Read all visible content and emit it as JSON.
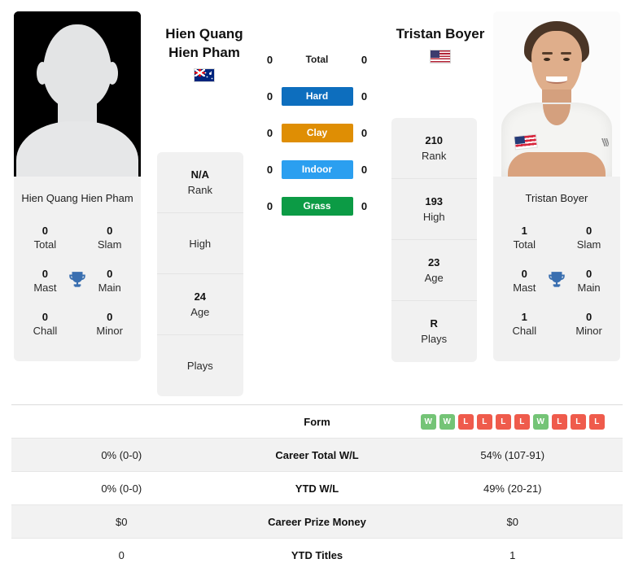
{
  "players": {
    "left": {
      "name": "Hien Quang Hien Pham",
      "header_line1": "Hien Quang",
      "header_line2": "Hien Pham",
      "flag": "australia-flag",
      "photo": "silhouette-placeholder",
      "titles": {
        "total_value": "0",
        "total_label": "Total",
        "slam_value": "0",
        "slam_label": "Slam",
        "mast_value": "0",
        "mast_label": "Mast",
        "main_value": "0",
        "main_label": "Main",
        "chall_value": "0",
        "chall_label": "Chall",
        "minor_value": "0",
        "minor_label": "Minor"
      },
      "info": [
        {
          "value": "N/A",
          "label": "Rank"
        },
        {
          "value": "",
          "label": "High"
        },
        {
          "value": "24",
          "label": "Age"
        },
        {
          "value": "",
          "label": "Plays"
        }
      ]
    },
    "right": {
      "name": "Tristan Boyer",
      "header_line1": "Tristan Boyer",
      "header_line2": "",
      "flag": "usa-flag",
      "photo": "player-portrait",
      "titles": {
        "total_value": "1",
        "total_label": "Total",
        "slam_value": "0",
        "slam_label": "Slam",
        "mast_value": "0",
        "mast_label": "Mast",
        "main_value": "0",
        "main_label": "Main",
        "chall_value": "1",
        "chall_label": "Chall",
        "minor_value": "0",
        "minor_label": "Minor"
      },
      "info": [
        {
          "value": "210",
          "label": "Rank"
        },
        {
          "value": "193",
          "label": "High"
        },
        {
          "value": "23",
          "label": "Age"
        },
        {
          "value": "R",
          "label": "Plays"
        }
      ]
    }
  },
  "surfaces": [
    {
      "label": "Total",
      "left": "0",
      "right": "0",
      "color": "transparent",
      "plain": true
    },
    {
      "label": "Hard",
      "left": "0",
      "right": "0",
      "color": "#0d6ebe",
      "plain": false
    },
    {
      "label": "Clay",
      "left": "0",
      "right": "0",
      "color": "#df8e04",
      "plain": false
    },
    {
      "label": "Indoor",
      "left": "0",
      "right": "0",
      "color": "#2b9ff0",
      "plain": false
    },
    {
      "label": "Grass",
      "left": "0",
      "right": "0",
      "color": "#0c9b45",
      "plain": false
    }
  ],
  "stats_table": {
    "form_label": "Form",
    "form_left": [],
    "form_right": [
      "W",
      "W",
      "L",
      "L",
      "L",
      "L",
      "W",
      "L",
      "L",
      "L"
    ],
    "rows": [
      {
        "label": "Career Total W/L",
        "left": "0% (0-0)",
        "right": "54% (107-91)"
      },
      {
        "label": "YTD W/L",
        "left": "0% (0-0)",
        "right": "49% (20-21)"
      },
      {
        "label": "Career Prize Money",
        "left": "$0",
        "right": "$0"
      },
      {
        "label": "YTD Titles",
        "left": "0",
        "right": "1"
      }
    ]
  },
  "colors": {
    "hard": "#0d6ebe",
    "clay": "#df8e04",
    "indoor": "#2b9ff0",
    "grass": "#0c9b45",
    "win_badge": "#74c476",
    "loss_badge": "#ef5b4c",
    "trophy": "#3a6fb0",
    "card_bg": "#f1f1f1"
  }
}
